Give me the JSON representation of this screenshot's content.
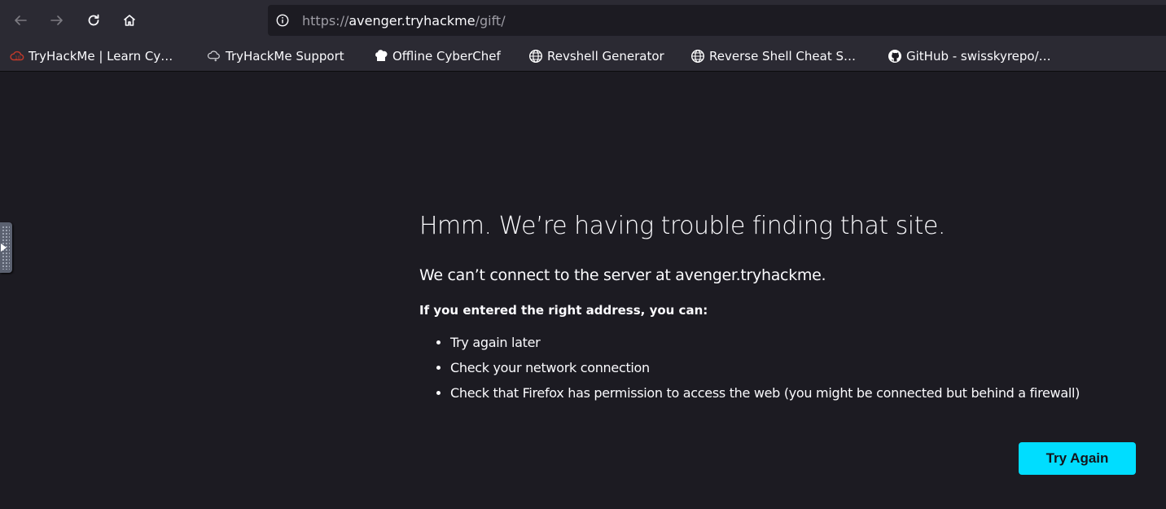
{
  "browser": {
    "url_scheme": "https://",
    "url_host": "avenger.tryhackme",
    "url_path": "/gift/",
    "icons": {
      "back": "arrow-left-icon",
      "forward": "arrow-right-icon",
      "reload": "reload-icon",
      "home": "home-icon",
      "site_info": "info-circle-icon"
    }
  },
  "bookmarks": [
    {
      "label": "TryHackMe | Learn Cy…",
      "icon": "tryhackme-cloud-icon",
      "color": "#c0392b"
    },
    {
      "label": "TryHackMe Support",
      "icon": "cloud-support-icon",
      "color": "#d0d0d5"
    },
    {
      "label": "Offline CyberChef",
      "icon": "chef-hat-icon",
      "color": "#ffffff"
    },
    {
      "label": "Revshell Generator",
      "icon": "globe-icon",
      "color": "#ffffff"
    },
    {
      "label": "Reverse Shell Cheat S…",
      "icon": "globe-icon",
      "color": "#ffffff"
    },
    {
      "label": "GitHub - swisskyrepo/…",
      "icon": "github-icon",
      "color": "#ffffff"
    }
  ],
  "error_page": {
    "title": "Hmm. We’re having trouble finding that site.",
    "description": "We can’t connect to the server at avenger.tryhackme.",
    "subheading": "If you entered the right address, you can:",
    "suggestions": [
      "Try again later",
      "Check your network connection",
      "Check that Firefox has permission to access the web (you might be connected but behind a firewall)"
    ],
    "button_label": "Try Again"
  },
  "colors": {
    "page_bg": "#1c1b22",
    "toolbar_bg": "#2b2a33",
    "accent": "#00ddff"
  }
}
